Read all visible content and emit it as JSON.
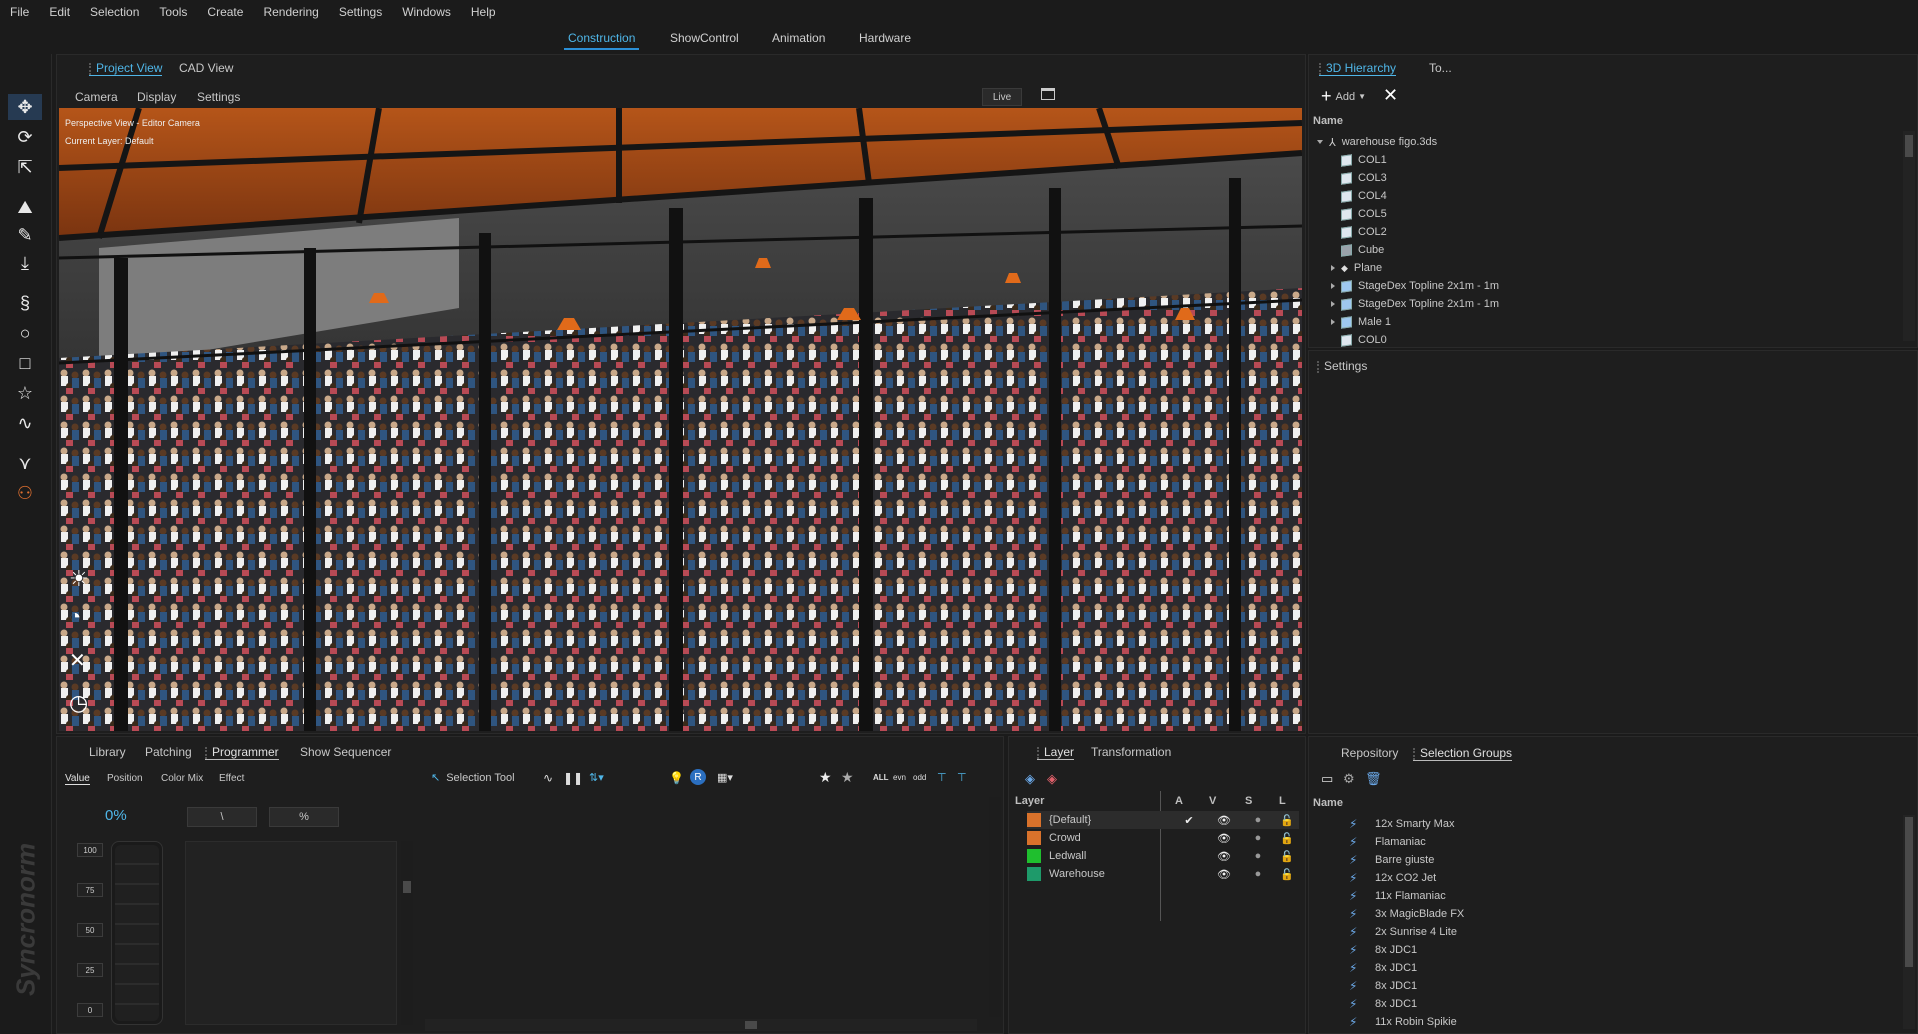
{
  "menu": [
    "File",
    "Edit",
    "Selection",
    "Tools",
    "Create",
    "Rendering",
    "Settings",
    "Windows",
    "Help"
  ],
  "modes": [
    "Construction",
    "ShowControl",
    "Animation",
    "Hardware"
  ],
  "view_tabs": [
    "Project View",
    "CAD View"
  ],
  "view_menu": [
    "Camera",
    "Display",
    "Settings"
  ],
  "live_label": "Live",
  "overlay": {
    "line1": "Perspective View - Editor Camera",
    "line2": "Current Layer: Default"
  },
  "hierarchy": {
    "tabs": [
      "3D Hierarchy",
      "To..."
    ],
    "add_label": "Add",
    "name_header": "Name",
    "items": [
      {
        "label": "warehouse figo.3ds",
        "level": 0,
        "expander": "down",
        "icon": "root"
      },
      {
        "label": "COL1",
        "level": 1,
        "expander": "none",
        "icon": "cube"
      },
      {
        "label": "COL3",
        "level": 1,
        "expander": "none",
        "icon": "cube"
      },
      {
        "label": "COL4",
        "level": 1,
        "expander": "none",
        "icon": "cube"
      },
      {
        "label": "COL5",
        "level": 1,
        "expander": "none",
        "icon": "cube"
      },
      {
        "label": "COL2",
        "level": 1,
        "expander": "none",
        "icon": "cube"
      },
      {
        "label": "Cube",
        "level": 1,
        "expander": "none",
        "icon": "cube-grey"
      },
      {
        "label": "Plane",
        "level": 1,
        "expander": "right",
        "icon": "plane"
      },
      {
        "label": "StageDex Topline 2x1m - 1m",
        "level": 1,
        "expander": "right",
        "icon": "cube-blue"
      },
      {
        "label": "StageDex Topline 2x1m - 1m",
        "level": 1,
        "expander": "right",
        "icon": "cube-blue"
      },
      {
        "label": "Male 1",
        "level": 1,
        "expander": "right",
        "icon": "cube-blue"
      },
      {
        "label": "COL0",
        "level": 1,
        "expander": "none",
        "icon": "cube"
      }
    ]
  },
  "settings_label": "Settings",
  "bottom_tabs": [
    "Library",
    "Patching",
    "Programmer",
    "Show Sequencer"
  ],
  "programmer": {
    "subtabs": [
      "Value",
      "Position",
      "Color Mix",
      "Effect"
    ],
    "percent": "0%",
    "btn_slash": "\\",
    "btn_percent": "%",
    "fader_ticks": [
      "100",
      "75",
      "50",
      "25",
      "0"
    ],
    "selection_tool": "Selection Tool",
    "filters": [
      "ALL",
      "evn",
      "odd"
    ]
  },
  "layers": {
    "tabs": [
      "Layer",
      "Transformation"
    ],
    "headers": [
      "Layer",
      "A",
      "V",
      "S",
      "L"
    ],
    "rows": [
      {
        "name": "{Default}",
        "color": "#d9722b",
        "active": true
      },
      {
        "name": "Crowd",
        "color": "#d9722b",
        "active": false
      },
      {
        "name": "Ledwall",
        "color": "#1fbf2e",
        "active": false
      },
      {
        "name": "Warehouse",
        "color": "#1e9a6a",
        "active": false
      }
    ]
  },
  "selection_groups": {
    "tabs": [
      "Repository",
      "Selection Groups"
    ],
    "name_header": "Name",
    "items": [
      "12x Smarty Max",
      "Flamaniac",
      "Barre giuste",
      "12x CO2 Jet",
      "11x Flamaniac",
      "3x MagicBlade FX",
      "2x Sunrise 4 Lite",
      "8x JDC1",
      "8x JDC1",
      "8x JDC1",
      "8x JDC1",
      "11x Robin Spikie"
    ]
  },
  "brand": "Syncronorm"
}
